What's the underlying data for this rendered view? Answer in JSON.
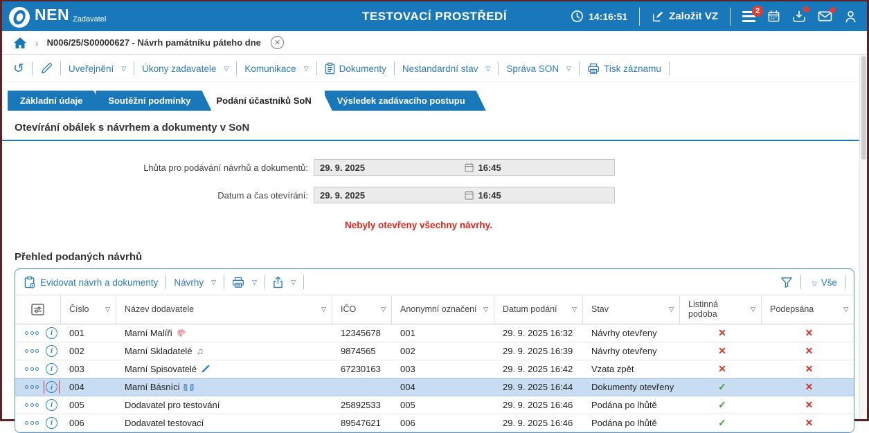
{
  "topbar": {
    "logo": "NEN",
    "logo_subtitle": "Zadavatel",
    "title": "TESTOVACÍ PROSTŘEDÍ",
    "time": "14:16:51",
    "create_vz_label": "Založit VZ",
    "menu_badge": "2"
  },
  "breadcrumb": {
    "item": "N006/25/S00000627 - Návrh památníku páteho dne"
  },
  "actionbar": {
    "items": [
      {
        "label": "Uveřejnění",
        "dropdown": true
      },
      {
        "label": "Úkony zadavatele",
        "dropdown": true
      },
      {
        "label": "Komunikace",
        "dropdown": true
      },
      {
        "label": "Dokumenty",
        "dropdown": false,
        "icon": "clipboard"
      },
      {
        "label": "Nestandardní stav",
        "dropdown": true
      },
      {
        "label": "Správa SON",
        "dropdown": true
      },
      {
        "label": "Tisk záznamu",
        "dropdown": false,
        "icon": "printer"
      }
    ]
  },
  "tabs": [
    {
      "label": "Základní údaje",
      "active": false
    },
    {
      "label": "Soutěžní podmínky",
      "active": false
    },
    {
      "label": "Podání účastníků SoN",
      "active": true
    },
    {
      "label": "Výsledek zadávacího postupu",
      "active": false
    }
  ],
  "section": {
    "title": "Otevírání obálek s návrhem a dokumenty v SoN",
    "fields": [
      {
        "label": "Lhůta pro podávání návrhů a dokumentů:",
        "date": "29. 9. 2025",
        "time": "16:45"
      },
      {
        "label": "Datum a čas otevírání:",
        "date": "29. 9. 2025",
        "time": "16:45"
      }
    ],
    "warning": "Nebyly otevřeny všechny návrhy."
  },
  "table_section": {
    "title": "Přehled podaných návrhů",
    "toolbar": {
      "evidovat": "Evidovat návrh a dokumenty",
      "navrhy": "Návrhy",
      "vse": "Vše"
    },
    "columns": [
      "Číslo",
      "Název dodavatele",
      "IČO",
      "Anonymní označení",
      "Datum podání",
      "Stav",
      "Listinná podoba",
      "Podepsána"
    ],
    "rows": [
      {
        "cislo": "001",
        "nazev": "Marní Malíři",
        "icon": "palette",
        "ico": "12345678",
        "anon": "001",
        "datum": "29. 9. 2025 16:32",
        "stav": "Návrhy otevřeny",
        "listinna": "no",
        "podepsana": "no",
        "selected": false,
        "info_outlined": false
      },
      {
        "cislo": "002",
        "nazev": "Marní Skladatelé",
        "icon": "music",
        "ico": "9874565",
        "anon": "002",
        "datum": "29. 9. 2025 16:39",
        "stav": "Návrhy otevřeny",
        "listinna": "no",
        "podepsana": "no",
        "selected": false,
        "info_outlined": false
      },
      {
        "cislo": "003",
        "nazev": "Marní Spisovatelé",
        "icon": "pen",
        "ico": "67230163",
        "anon": "003",
        "datum": "29. 9. 2025 16:42",
        "stav": "Vzata zpět",
        "listinna": "no",
        "podepsana": "no",
        "selected": false,
        "info_outlined": false
      },
      {
        "cislo": "004",
        "nazev": "Marní Básníci",
        "icon": "book",
        "ico": "",
        "anon": "004",
        "datum": "29. 9. 2025 16:44",
        "stav": "Dokumenty otevřeny",
        "listinna": "yes",
        "podepsana": "no",
        "selected": true,
        "info_outlined": true
      },
      {
        "cislo": "005",
        "nazev": "Dodavatel pro testování",
        "icon": "",
        "ico": "25892533",
        "anon": "005",
        "datum": "29. 9. 2025 16:46",
        "stav": "Podána po lhůtě",
        "listinna": "yes",
        "podepsana": "no",
        "selected": false,
        "info_outlined": false
      },
      {
        "cislo": "006",
        "nazev": "Dodavatel testovací",
        "icon": "",
        "ico": "89547621",
        "anon": "006",
        "datum": "29. 9. 2025 16:46",
        "stav": "Podána po lhůtě",
        "listinna": "yes",
        "podepsana": "no",
        "selected": false,
        "info_outlined": false
      }
    ]
  },
  "colors": {
    "accent": "#1878b9",
    "link": "#2b7bb9",
    "warning": "#e0261c",
    "check_green": "#3fa33f",
    "cross_red": "#d3352b",
    "selected_row": "#c8ddf1",
    "frame": "#5c2326"
  }
}
